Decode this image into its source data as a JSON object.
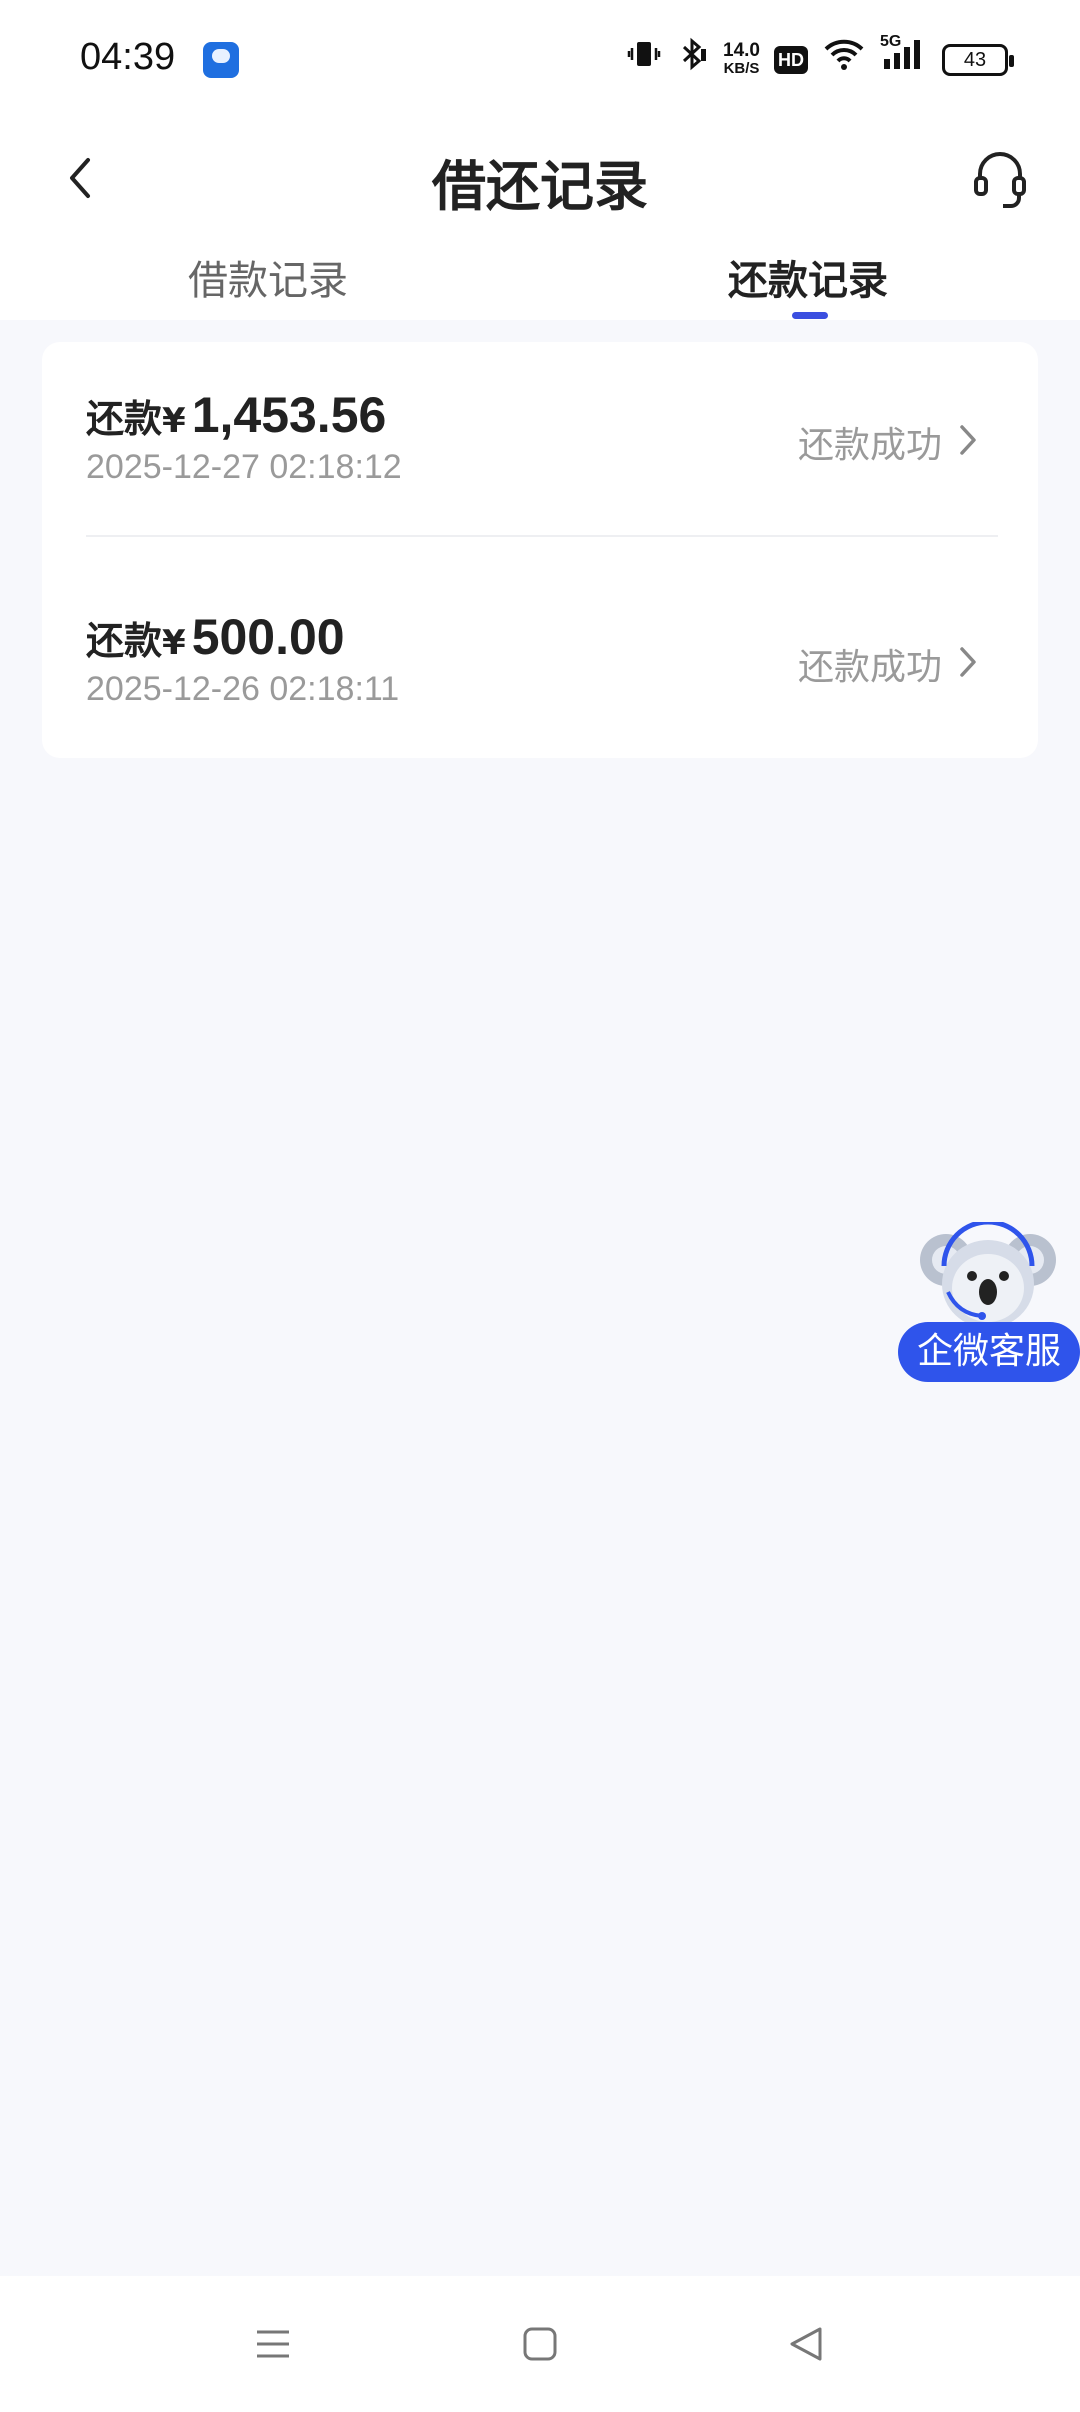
{
  "status_bar": {
    "time": "04:39",
    "network_speed": "14.0",
    "network_speed_unit": "KB/S",
    "hd_label": "HD",
    "signal_label": "5G",
    "battery_level": "43"
  },
  "header": {
    "title": "借还记录"
  },
  "tabs": [
    {
      "label": "借款记录",
      "active": false
    },
    {
      "label": "还款记录",
      "active": true
    }
  ],
  "records": [
    {
      "prefix": "还款",
      "currency": "¥",
      "amount": "1,453.56",
      "datetime": "2025-12-27 02:18:12",
      "status": "还款成功"
    },
    {
      "prefix": "还款",
      "currency": "¥",
      "amount": "500.00",
      "datetime": "2025-12-26 02:18:11",
      "status": "还款成功"
    }
  ],
  "float_service": {
    "label": "企微客服"
  },
  "colors": {
    "accent": "#2f54eb",
    "tab_indicator": "#3b4fe0",
    "page_bg": "#f7f8fc",
    "muted_text": "#9a9a9a"
  },
  "icons": {
    "back": "chevron-left-icon",
    "support": "headset-icon",
    "record_arrow": "chevron-right-icon",
    "mascot": "koala-icon"
  }
}
